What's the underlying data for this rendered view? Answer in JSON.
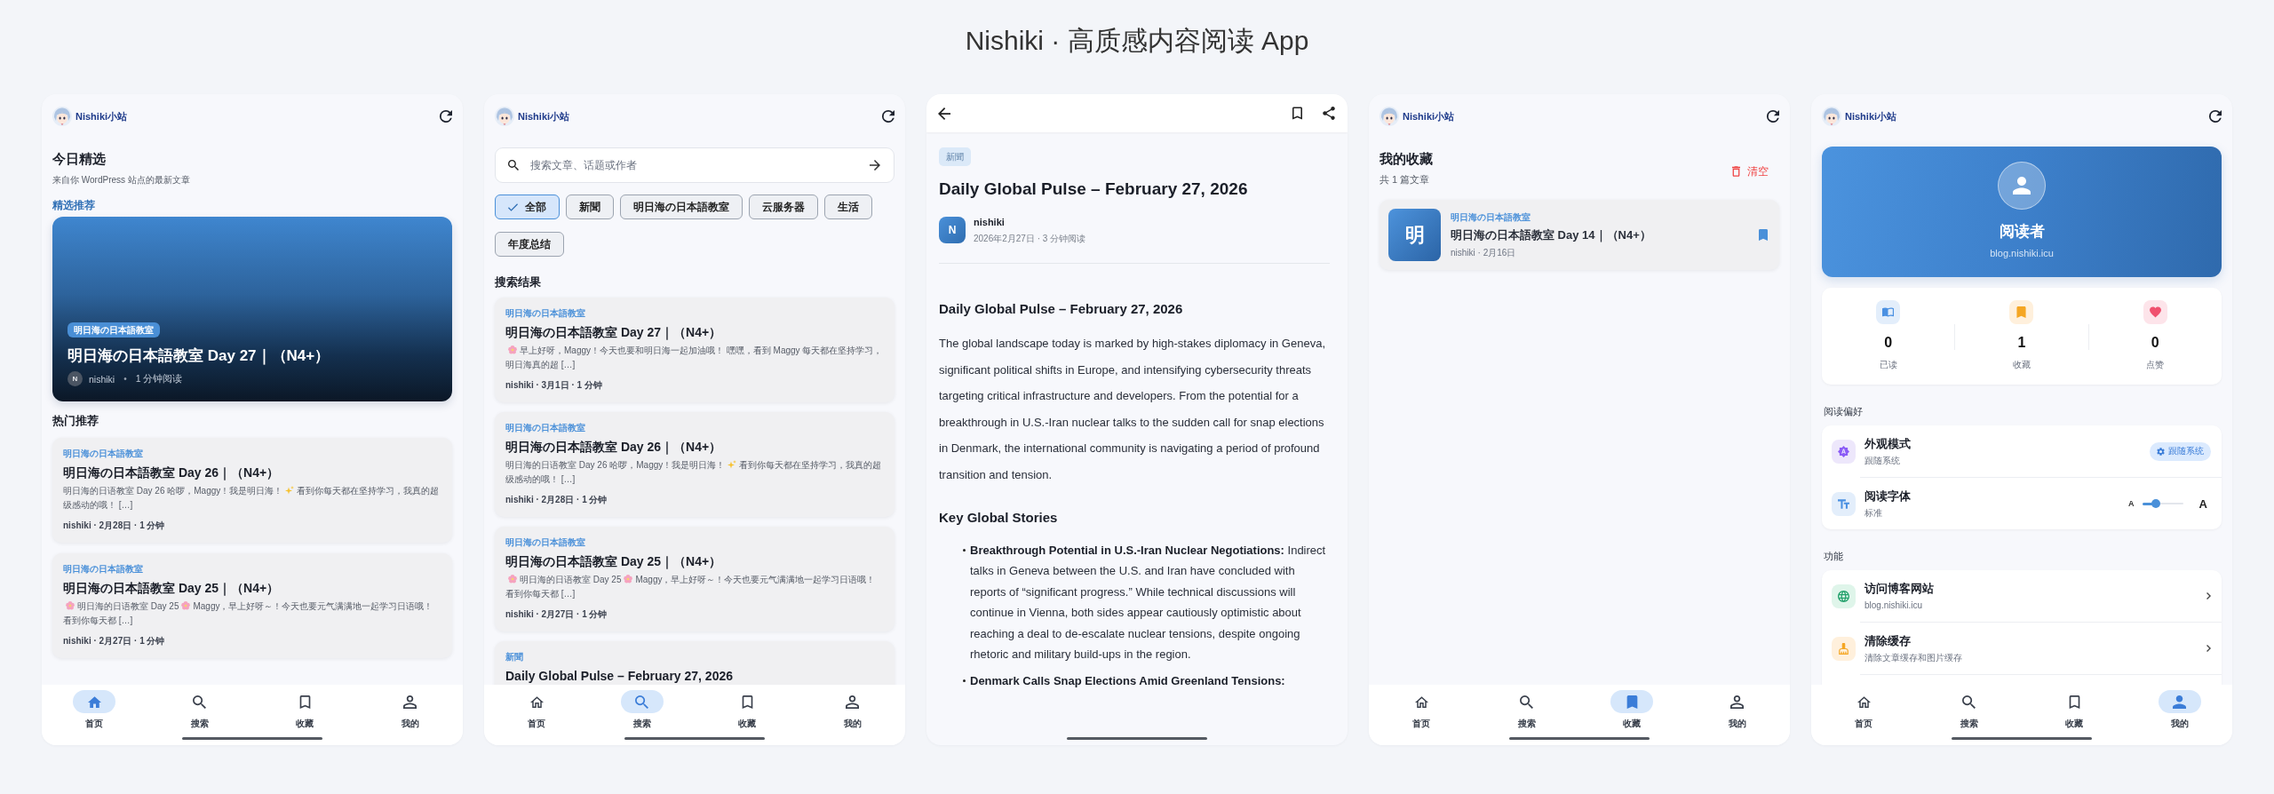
{
  "page_title": "Nishiki · 高质感内容阅读 App",
  "screens": [
    {
      "kind": "home",
      "header": {
        "site_name": "Nishiki小站"
      },
      "heading": "今日精选",
      "subheading": "来自你 WordPress 站点的最新文章",
      "featured_label": "精选推荐",
      "featured": {
        "category": "明日海の日本語教室",
        "title": "明日海の日本語教室 Day 27｜（N4+）",
        "author_initial": "N",
        "author": "nishiki",
        "separator": "•",
        "read_time": "1 分钟阅读"
      },
      "section_title": "热门推荐",
      "articles": [
        {
          "category": "明日海の日本語教室",
          "title": "明日海の日本語教室 Day 26｜（N4+）",
          "excerpt": [
            {
              "kind": "text",
              "text": "明日海的日语教室 Day 26 哈啰，Maggy！我是明日海！"
            },
            {
              "kind": "sparkle"
            },
            {
              "kind": "text",
              "text": "看到你每天都在坚持学习，我真的超级感动的哦！ […]"
            }
          ],
          "meta": "nishiki · 2月28日 · 1 分钟"
        },
        {
          "category": "明日海の日本語教室",
          "title": "明日海の日本語教室 Day 25｜（N4+）",
          "excerpt": [
            {
              "kind": "blossom"
            },
            {
              "kind": "text",
              "text": "明日海的日语教室 Day 25"
            },
            {
              "kind": "blossom"
            },
            {
              "kind": "text",
              "text": "Maggy，早上好呀～！今天也要元气满满地一起学习日语哦！看到你每天都 […]"
            }
          ],
          "meta": "nishiki · 2月27日 · 1 分钟"
        }
      ],
      "nav": [
        {
          "label": "首页",
          "selected": true
        },
        {
          "label": "搜索",
          "selected": false
        },
        {
          "label": "收藏",
          "selected": false
        },
        {
          "label": "我的",
          "selected": false
        }
      ]
    },
    {
      "kind": "search",
      "header": {
        "site_name": "Nishiki小站"
      },
      "search": {
        "placeholder": "搜索文章、话题或作者"
      },
      "filters": [
        {
          "label": "全部",
          "selected": true
        },
        {
          "label": "新聞",
          "selected": false
        },
        {
          "label": "明日海の日本語教室",
          "selected": false
        },
        {
          "label": "云服务器",
          "selected": false
        },
        {
          "label": "生活",
          "selected": false
        },
        {
          "label": "年度总结",
          "selected": false
        }
      ],
      "section_title": "搜索结果",
      "articles": [
        {
          "category": "明日海の日本語教室",
          "title": "明日海の日本語教室 Day 27｜（N4+）",
          "excerpt": [
            {
              "kind": "blossom"
            },
            {
              "kind": "text",
              "text": "早上好呀，Maggy！今天也要和明日海一起加油哦！ 嘿嘿，看到 Maggy 每天都在坚持学习，明日海真的超 […]"
            }
          ],
          "meta": "nishiki · 3月1日 · 1 分钟"
        },
        {
          "category": "明日海の日本語教室",
          "title": "明日海の日本語教室 Day 26｜（N4+）",
          "excerpt": [
            {
              "kind": "text",
              "text": "明日海的日语教室 Day 26 哈啰，Maggy！我是明日海！"
            },
            {
              "kind": "sparkle"
            },
            {
              "kind": "text",
              "text": "看到你每天都在坚持学习，我真的超级感动的哦！ […]"
            }
          ],
          "meta": "nishiki · 2月28日 · 1 分钟"
        },
        {
          "category": "明日海の日本語教室",
          "title": "明日海の日本語教室 Day 25｜（N4+）",
          "excerpt": [
            {
              "kind": "blossom"
            },
            {
              "kind": "text",
              "text": "明日海的日语教室 Day 25"
            },
            {
              "kind": "blossom"
            },
            {
              "kind": "text",
              "text": "Maggy，早上好呀～！今天也要元气满满地一起学习日语哦！看到你每天都 […]"
            }
          ],
          "meta": "nishiki · 2月27日 · 1 分钟"
        },
        {
          "category": "新聞",
          "title": "Daily Global Pulse – February 27, 2026"
        }
      ],
      "nav": [
        {
          "label": "首页",
          "selected": false
        },
        {
          "label": "搜索",
          "selected": true
        },
        {
          "label": "收藏",
          "selected": false
        },
        {
          "label": "我的",
          "selected": false
        }
      ]
    },
    {
      "kind": "article",
      "article": {
        "bookmarked": false,
        "category": "新聞",
        "title": "Daily Global Pulse – February 27, 2026",
        "author_initial": "N",
        "author": "nishiki",
        "meta": "2026年2月27日 · 3 分钟阅读",
        "body": [
          {
            "kind": "heading",
            "text": "Daily Global Pulse – February 27, 2026"
          },
          {
            "kind": "paragraph",
            "text": "The global landscape today is marked by high-stakes diplomacy in Geneva, significant political shifts in Europe, and intensifying cybersecurity threats targeting critical infrastructure and developers. From the potential for a breakthrough in U.S.-Iran nuclear talks to the sudden call for snap elections in Denmark, the international community is navigating a period of profound transition and tension."
          },
          {
            "kind": "heading",
            "text": "Key Global Stories"
          },
          {
            "kind": "list",
            "items": [
              {
                "lead": "Breakthrough Potential in U.S.-Iran Nuclear Negotiations:",
                "text": "Indirect talks in Geneva between the U.S. and Iran have concluded with reports of “significant progress.” While technical discussions will continue in Vienna, both sides appear cautiously optimistic about reaching a deal to de-escalate nuclear tensions, despite ongoing rhetoric and military build-ups in the region."
              },
              {
                "lead": "Denmark Calls Snap Elections Amid Greenland Tensions:"
              }
            ]
          }
        ]
      }
    },
    {
      "kind": "favorites",
      "header": {
        "site_name": "Nishiki小站"
      },
      "heading": "我的收藏",
      "count": "共 1 篇文章",
      "clear_label": "清空",
      "articles": [
        {
          "thumb_text": "明",
          "category": "明日海の日本語教室",
          "title": "明日海の日本語教室 Day 14｜（N4+）",
          "meta": "nishiki · 2月16日",
          "bookmarked": true
        }
      ],
      "nav": [
        {
          "label": "首页",
          "selected": false
        },
        {
          "label": "搜索",
          "selected": false
        },
        {
          "label": "收藏",
          "selected": true
        },
        {
          "label": "我的",
          "selected": false
        }
      ]
    },
    {
      "kind": "profile",
      "header": {
        "site_name": "Nishiki小站"
      },
      "profile": {
        "name": "阅读者",
        "site": "blog.nishiki.icu"
      },
      "stats": [
        {
          "value": "0",
          "label": "已读"
        },
        {
          "value": "1",
          "label": "收藏"
        },
        {
          "value": "0",
          "label": "点赞"
        }
      ],
      "sections": [
        {
          "title": "阅读偏好",
          "rows": [
            {
              "kind": "chip",
              "title": "外观模式",
              "subtitle": "跟随系统",
              "chip": "跟随系统"
            },
            {
              "kind": "slider",
              "title": "阅读字体",
              "subtitle": "标准",
              "min_label": "A",
              "max_label": "A",
              "level": 0.33
            }
          ]
        },
        {
          "title": "功能",
          "rows": [
            {
              "kind": "link",
              "title": "访问博客网站",
              "subtitle": "blog.nishiki.icu"
            },
            {
              "kind": "link",
              "title": "清除缓存",
              "subtitle": "清除文章缓存和图片缓存"
            }
          ]
        }
      ],
      "nav": [
        {
          "label": "首页",
          "selected": false
        },
        {
          "label": "搜索",
          "selected": false
        },
        {
          "label": "收藏",
          "selected": false
        },
        {
          "label": "我的",
          "selected": true
        }
      ]
    }
  ]
}
